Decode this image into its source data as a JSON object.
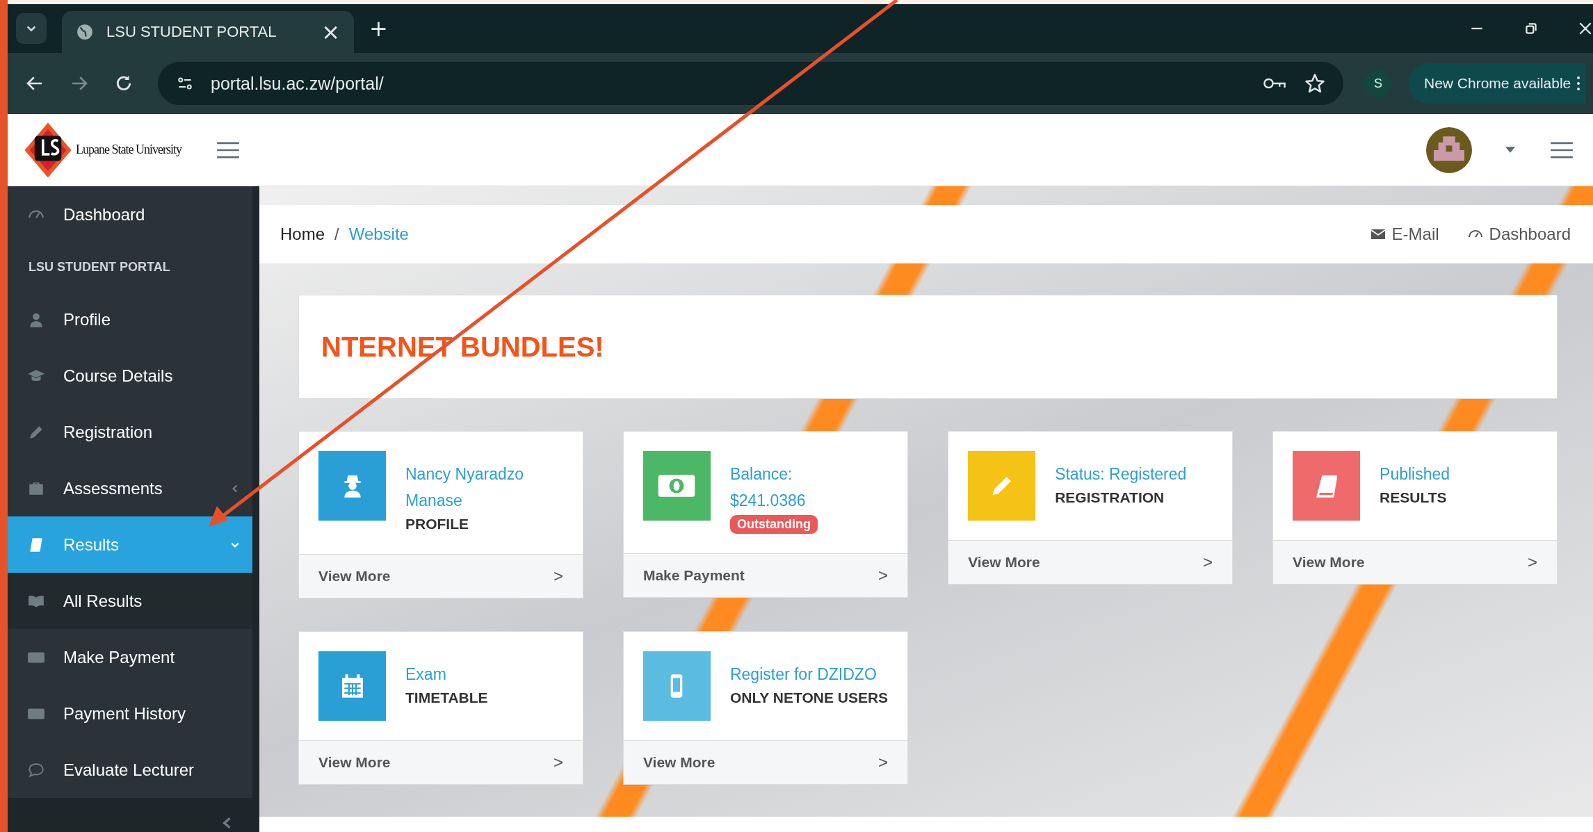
{
  "browser": {
    "tab": {
      "title": "LSU STUDENT PORTAL",
      "close": "×"
    },
    "new_tab": "+",
    "url": "portal.lsu.ac.zw/portal/",
    "profile_initial": "S",
    "update_button": "New Chrome available"
  },
  "header": {
    "logo_text": "Lupane State University"
  },
  "sidebar": {
    "items": [
      {
        "kind": "link",
        "label": "Dashboard",
        "selected": false
      },
      {
        "kind": "header",
        "label": "LSU STUDENT PORTAL"
      },
      {
        "kind": "link",
        "label": "Profile",
        "selected": false
      },
      {
        "kind": "link",
        "label": "Course Details",
        "selected": false
      },
      {
        "kind": "link",
        "label": "Registration",
        "selected": false
      },
      {
        "kind": "group",
        "label": "Assessments",
        "selected": false,
        "expanded": false
      },
      {
        "kind": "group",
        "label": "Results",
        "selected": true,
        "expanded": true
      },
      {
        "kind": "subitem",
        "label": "All Results",
        "selected": false
      },
      {
        "kind": "link",
        "label": "Make Payment",
        "selected": false
      },
      {
        "kind": "link",
        "label": "Payment History",
        "selected": false
      },
      {
        "kind": "link",
        "label": "Evaluate Lecturer",
        "selected": false
      }
    ]
  },
  "breadcrumb": {
    "items": [
      "Home",
      "Website"
    ],
    "separator": "/",
    "links": [
      "E-Mail",
      "Dashboard"
    ]
  },
  "banner": {
    "text": "NTERNET BUNDLES!"
  },
  "cards": [
    {
      "kind": "user",
      "color": "#2a9fd6",
      "title": "Nancy Nyaradzo Manase",
      "subtitle": "PROFILE",
      "footer": "View More",
      "chevron": ">"
    },
    {
      "kind": "money",
      "color": "#4cb865",
      "title": "Balance:",
      "amount": "$241.0386",
      "badge": "Outstanding",
      "footer": "Make Payment",
      "chevron": ">"
    },
    {
      "kind": "pencil",
      "color": "#f5c316",
      "title": "Status: Registered",
      "subtitle": "REGISTRATION",
      "footer": "View More",
      "chevron": ">"
    },
    {
      "kind": "book",
      "color": "#ef6b6b",
      "title": "Published",
      "subtitle": "RESULTS",
      "footer": "View More",
      "chevron": ">"
    },
    {
      "kind": "calendar",
      "color": "#2a9fd6",
      "title": "Exam",
      "subtitle": "TIMETABLE",
      "footer": "View More",
      "chevron": ">"
    },
    {
      "kind": "mobile",
      "color": "#5bbbe0",
      "title": "Register for DZIDZO",
      "subtitle": "ONLY NETONE USERS",
      "footer": "View More",
      "chevron": ">"
    }
  ]
}
